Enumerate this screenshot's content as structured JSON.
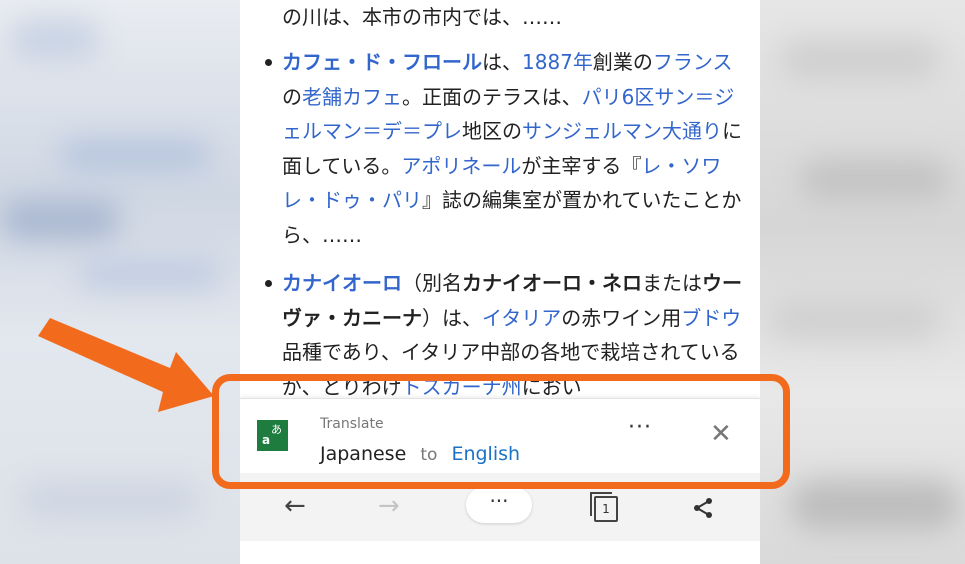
{
  "article": {
    "line0": "の川は、本市の市内では、……",
    "p1": [
      {
        "t": "カフェ・ド・フロール",
        "k": "lb"
      },
      {
        "t": "は、",
        "k": "n"
      },
      {
        "t": "1887年",
        "k": "l"
      },
      {
        "t": "創業の",
        "k": "n"
      },
      {
        "t": "フランス",
        "k": "l"
      },
      {
        "t": "の",
        "k": "n"
      },
      {
        "t": "老舗",
        "k": "l"
      },
      {
        "t": "カフェ",
        "k": "l"
      },
      {
        "t": "。正面のテラスは、",
        "k": "n"
      },
      {
        "t": "パリ6区",
        "k": "l"
      },
      {
        "t": "サン＝ジェルマン＝デ＝プレ",
        "k": "l"
      },
      {
        "t": "地区の",
        "k": "n"
      },
      {
        "t": "サンジェルマン大通り",
        "k": "l"
      },
      {
        "t": "に面している。",
        "k": "n"
      },
      {
        "t": "アポリネール",
        "k": "l"
      },
      {
        "t": "が主宰する『",
        "k": "n"
      },
      {
        "t": "レ・ソワレ・ドゥ・パリ",
        "k": "l"
      },
      {
        "t": "』誌の編集室が置かれていたことから、……",
        "k": "n"
      }
    ],
    "p2": [
      {
        "t": "カナイオーロ",
        "k": "lb"
      },
      {
        "t": "（別名",
        "k": "n"
      },
      {
        "t": "カナイオーロ・ネロ",
        "k": "b"
      },
      {
        "t": "または",
        "k": "n"
      },
      {
        "t": "ウーヴァ・カニーナ",
        "k": "b"
      },
      {
        "t": "）は、",
        "k": "n"
      },
      {
        "t": "イタリア",
        "k": "l"
      },
      {
        "t": "の赤ワイン用",
        "k": "n"
      },
      {
        "t": "ブドウ",
        "k": "l"
      },
      {
        "t": "品種であり、イタリア中部の各地で栽培されているが、とりわけ",
        "k": "n"
      },
      {
        "t": "トスカーナ州",
        "k": "l"
      },
      {
        "t": "におい",
        "k": "n"
      }
    ]
  },
  "translate_bar": {
    "label": "Translate",
    "source_lang": "Japanese",
    "connector": "to",
    "target_lang": "English",
    "more": "···",
    "close": "✕",
    "icon_name": "translate-icon",
    "icon_glyph_a": "a",
    "icon_glyph_b": "あ"
  },
  "toolbar": {
    "back": "←",
    "forward": "→",
    "more": "···",
    "tabs_count": "1",
    "share_icon": "share-icon"
  },
  "colors": {
    "link": "#3366cc",
    "annotation": "#f26b1d",
    "translate_green": "#1e7d3e",
    "target_lang": "#1a73c9"
  }
}
